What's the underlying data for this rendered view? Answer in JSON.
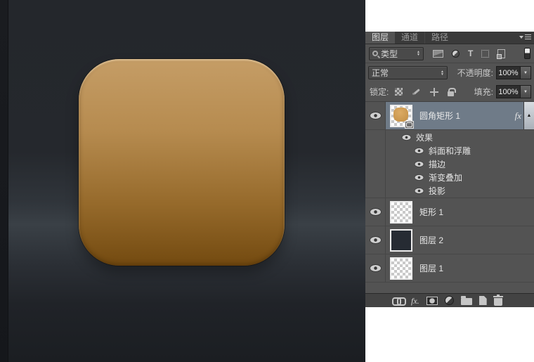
{
  "panel": {
    "tabs": [
      {
        "label": "图层",
        "active": true
      },
      {
        "label": "通道",
        "active": false
      },
      {
        "label": "路径",
        "active": false
      }
    ],
    "filter_row": {
      "type_label": "类型"
    },
    "blend_row": {
      "mode": "正常",
      "opacity_label": "不透明度:",
      "opacity_value": "100%"
    },
    "lock_row": {
      "lock_label": "锁定:",
      "fill_label": "填充:",
      "fill_value": "100%"
    },
    "layers": [
      {
        "name": "圆角矩形 1",
        "fx_label": "fx",
        "selected": true,
        "thumb": "shape-checker"
      },
      {
        "name": "矩形 1",
        "thumb": "checker"
      },
      {
        "name": "图层 2",
        "thumb": "dark-fill"
      },
      {
        "name": "图层 1",
        "thumb": "checker"
      }
    ],
    "effects": {
      "header": "效果",
      "items": [
        "斜面和浮雕",
        "描边",
        "渐变叠加",
        "投影"
      ]
    },
    "icons": {
      "type_filter_glyph": "T",
      "fx_bottom_glyph": "fx."
    }
  },
  "colors": {
    "panel_bg": "#535353",
    "selected_row": "#6f7b88",
    "canvas_bg": "#24272c",
    "canvas_band": "#3a4046",
    "icon_gradient_top": "#c59d66",
    "icon_gradient_bottom": "#734a10",
    "layer2_fill": "#262b33"
  }
}
